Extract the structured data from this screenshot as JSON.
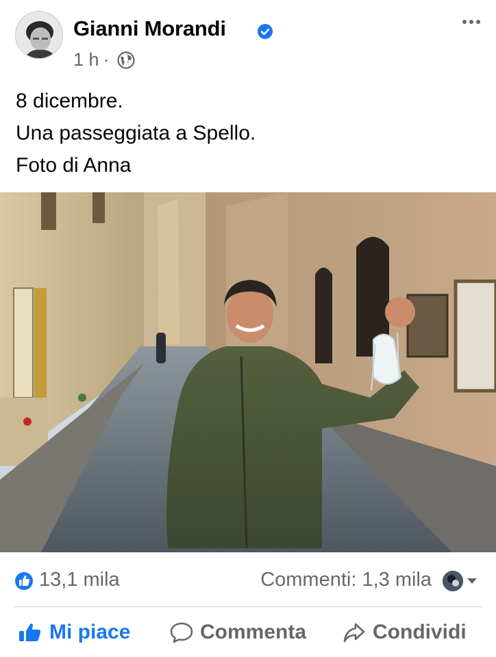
{
  "post": {
    "author": "Gianni Morandi",
    "time": "1 h",
    "separator": "·",
    "caption_lines": [
      "8 dicembre.",
      "Una passeggiata a Spello.",
      "Foto di Anna"
    ]
  },
  "icons": {
    "verified": "verified-badge-icon",
    "audience": "globe-icon",
    "menu": "more-options-icon",
    "like": "thumbs-up-icon",
    "comment": "speech-bubble-icon",
    "share": "share-arrow-icon"
  },
  "stats": {
    "likes": "13,1 mila",
    "comments": "Commenti: 1,3 mila"
  },
  "actions": {
    "like_label": "Mi piace",
    "comment_label": "Commenta",
    "share_label": "Condividi"
  },
  "colors": {
    "brand_blue": "#1877f2",
    "secondary_text": "#65676b",
    "primary_text": "#050505",
    "divider": "#ced0d4"
  }
}
